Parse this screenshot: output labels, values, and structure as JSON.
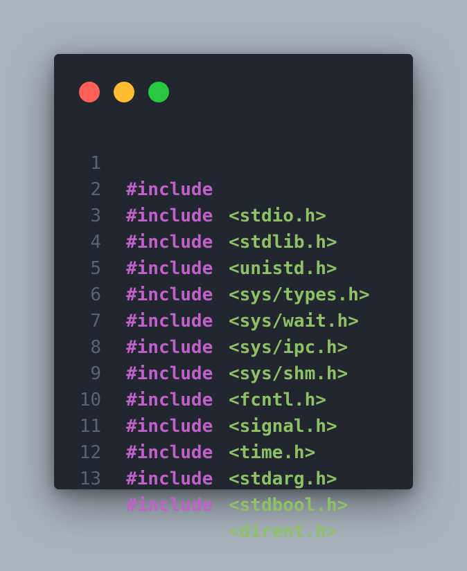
{
  "colors": {
    "background": "#a9b3bd",
    "window": "#22262e",
    "line_number": "#5b6272",
    "keyword": "#c061cb",
    "header": "#8cc265",
    "dot_red": "#ff5f57",
    "dot_yellow": "#febc2e",
    "dot_green": "#28c840"
  },
  "window_controls": {
    "close": "red-dot-icon",
    "minimize": "yellow-dot-icon",
    "maximize": "green-dot-icon"
  },
  "code": {
    "lines": [
      {
        "number": "1",
        "keyword": "#include",
        "header": "<stdio.h>"
      },
      {
        "number": "2",
        "keyword": "#include",
        "header": "<stdlib.h>"
      },
      {
        "number": "3",
        "keyword": "#include",
        "header": "<unistd.h>"
      },
      {
        "number": "4",
        "keyword": "#include",
        "header": "<sys/types.h>"
      },
      {
        "number": "5",
        "keyword": "#include",
        "header": "<sys/wait.h>"
      },
      {
        "number": "6",
        "keyword": "#include",
        "header": "<sys/ipc.h>"
      },
      {
        "number": "7",
        "keyword": "#include",
        "header": "<sys/shm.h>"
      },
      {
        "number": "8",
        "keyword": "#include",
        "header": "<fcntl.h>"
      },
      {
        "number": "9",
        "keyword": "#include",
        "header": "<signal.h>"
      },
      {
        "number": "10",
        "keyword": "#include",
        "header": "<time.h>"
      },
      {
        "number": "11",
        "keyword": "#include",
        "header": "<stdarg.h>"
      },
      {
        "number": "12",
        "keyword": "#include",
        "header": "<stdbool.h>"
      },
      {
        "number": "13",
        "keyword": "#include",
        "header": "<dirent.h>"
      }
    ]
  }
}
